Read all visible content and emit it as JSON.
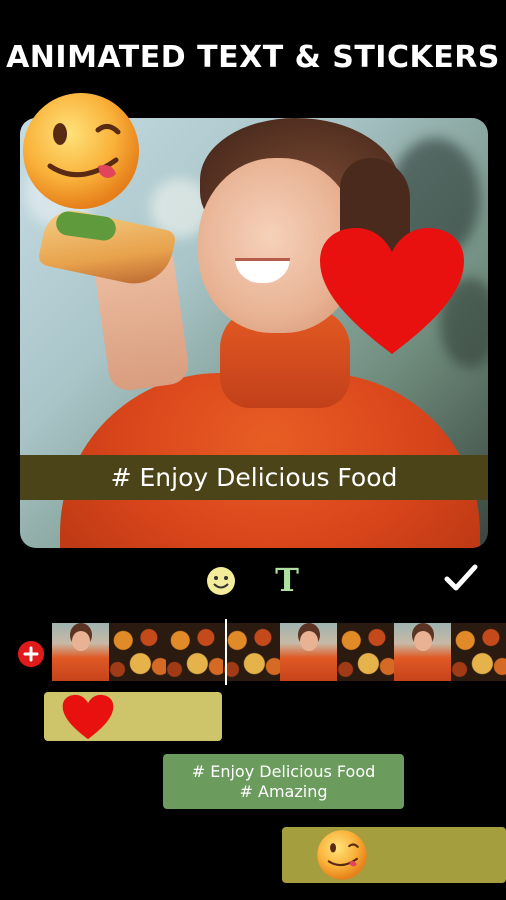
{
  "headline": "ANIMATED TEXT & STICKERS",
  "preview": {
    "caption": "# Enjoy Delicious Food",
    "stickers": [
      "tongue-wink-emoji",
      "red-heart"
    ]
  },
  "toolbar": {
    "tools": [
      "emoji-sticker-tool",
      "text-tool",
      "done-check"
    ],
    "text_tool_glyph": "T"
  },
  "timeline": {
    "frames": [
      "person",
      "food",
      "food",
      "food",
      "person",
      "food",
      "person",
      "food",
      "plate"
    ],
    "tracks": {
      "heart": "red-heart",
      "text_line1": "# Enjoy Delicious Food",
      "text_line2": "# Amazing",
      "emoji": "tongue-wink-emoji"
    }
  },
  "colors": {
    "background": "#000000",
    "caption_banner": "#4b4419",
    "heart": "#e8110f",
    "track_heart": "#cec46a",
    "track_text": "#6b9b5d",
    "track_emoji": "#a59e3e",
    "add_button": "#e01b1b"
  }
}
